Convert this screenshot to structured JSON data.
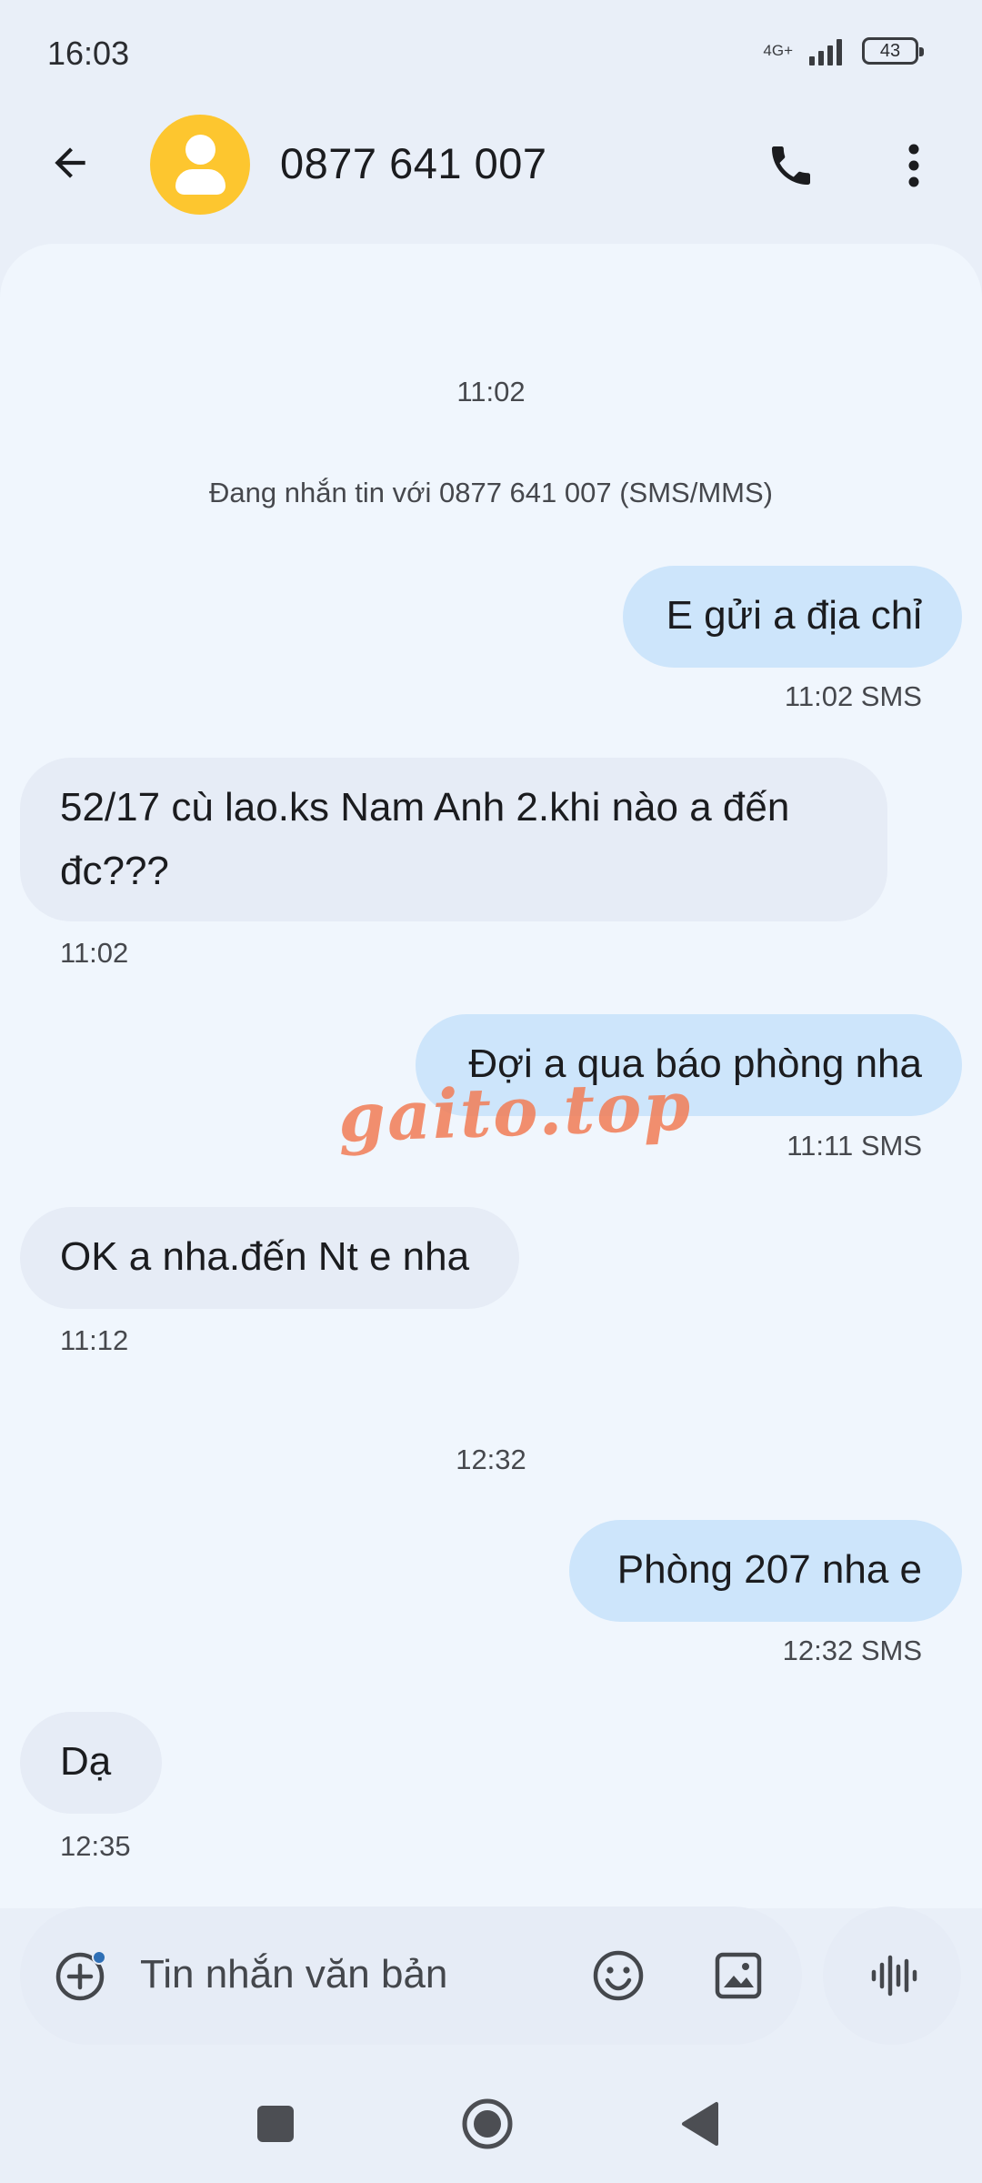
{
  "status_bar": {
    "time": "16:03",
    "network": "4G+",
    "battery": "43"
  },
  "header": {
    "contact": "0877 641 007"
  },
  "thread": {
    "notice": "Đang nhắn tin với 0877 641 007 (SMS/MMS)",
    "messages": [
      {
        "kind": "timestamp",
        "text": "11:02"
      },
      {
        "kind": "outgoing",
        "text": "E gửi a địa chỉ",
        "meta": "11:02 SMS"
      },
      {
        "kind": "incoming",
        "line1": "52/17 cù lao.ks Nam Anh 2.khi nào a đến",
        "line2": "đc???",
        "meta": "11:02"
      },
      {
        "kind": "outgoing",
        "text": "Đợi a qua báo phòng nha",
        "meta": "11:11 SMS"
      },
      {
        "kind": "incoming",
        "text": "OK a nha.đến Nt e nha",
        "meta": "11:12"
      },
      {
        "kind": "timestamp",
        "text": "12:32"
      },
      {
        "kind": "outgoing",
        "text": "Phòng 207 nha e",
        "meta": "12:32 SMS"
      },
      {
        "kind": "incoming",
        "text": "Dạ",
        "meta": "12:35"
      }
    ]
  },
  "watermark": "gaito.top",
  "composer": {
    "placeholder": "Tin nhắn văn bản"
  },
  "icons": {
    "back": "arrow-left-icon",
    "call": "phone-icon",
    "more": "more-vert-icon",
    "add": "add-circle-icon",
    "emoji": "emoji-icon",
    "image": "image-icon",
    "voice": "voice-wave-icon",
    "nav_recents": "square-icon",
    "nav_home": "circle-icon",
    "nav_back": "triangle-back-icon"
  },
  "colors": {
    "outgoing_bubble": "#cde5fb",
    "incoming_bubble": "#e6ecf6",
    "avatar": "#fdc62f",
    "watermark": "#f0805a"
  }
}
